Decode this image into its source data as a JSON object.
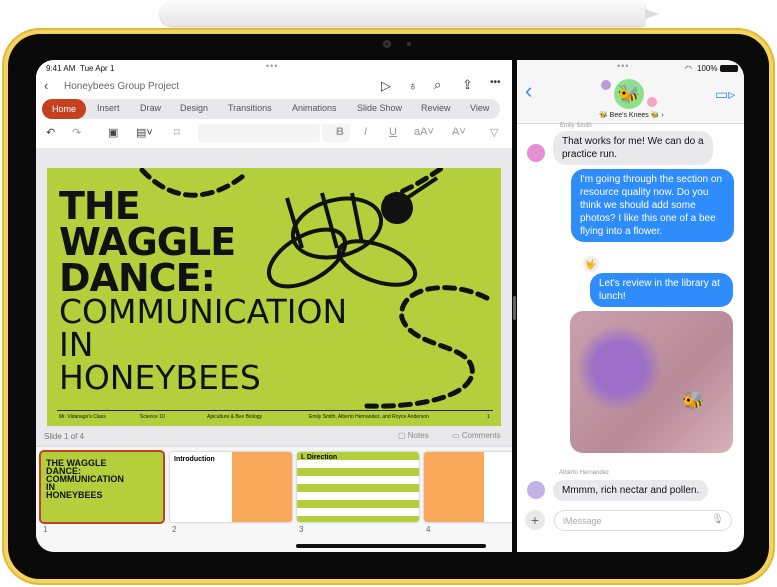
{
  "status": {
    "time": "9:41 AM",
    "date": "Tue Apr 1",
    "battery": "100%"
  },
  "ppt": {
    "title": "Honeybees Group Project",
    "tabs": [
      "Home",
      "Insert",
      "Draw",
      "Design",
      "Transitions",
      "Animations",
      "Slide Show",
      "Review",
      "View"
    ],
    "active_tab": "Home",
    "accent": "#c4401f",
    "slide": {
      "title_lines": [
        "THE",
        "WAGGLE",
        "DANCE:"
      ],
      "subtitle_lines": [
        "COMMUNICATION",
        "IN",
        "HONEYBEES"
      ],
      "footer": [
        "Mr. Vidanage's Class",
        "Science 10",
        "Apiculture & Bee Biology",
        "Emily Smith, Alberto Hernandez, and Royce Anderson",
        "1"
      ],
      "bg": "#b5cf3c"
    },
    "slide_counter": "Slide 1 of 4",
    "notes_label": "Notes",
    "comments_label": "Comments",
    "thumbnails": [
      {
        "num": "1",
        "label": "THE WAGGLE DANCE: COMMUNICATION IN HONEYBEES"
      },
      {
        "num": "2",
        "label": "Introduction"
      },
      {
        "num": "3",
        "label": "I. Direction"
      },
      {
        "num": "4",
        "label": ""
      }
    ]
  },
  "messages": {
    "group_name": "Bee's Knees",
    "items": [
      {
        "sender": "Emily Smith",
        "text": "That works for me! We can do a practice run."
      },
      {
        "text": "I'm going through the section on resource quality now. Do you think we should add some photos? I like this one of a bee flying into a flower."
      },
      {
        "text": "Let's review in the library at lunch!"
      },
      {
        "sender": "Alberto Hernandez",
        "text": "Mmmm, rich nectar and pollen."
      }
    ],
    "input_placeholder": "iMessage",
    "accent": "#2f8cfb"
  }
}
